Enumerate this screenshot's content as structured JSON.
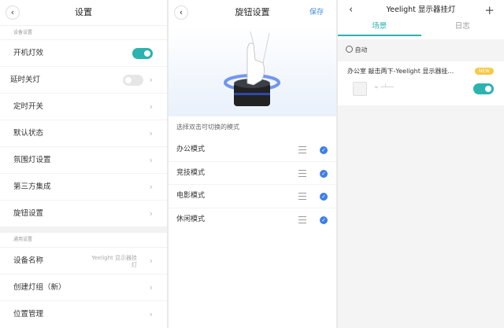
{
  "settings": {
    "title": "设置",
    "section1": "设备设置",
    "items1": [
      {
        "label": "开机灯效",
        "toggle": true
      },
      {
        "label": "延时关灯",
        "toggle": false
      },
      {
        "label": "定时开关"
      },
      {
        "label": "默认状态"
      },
      {
        "label": "氛围灯设置"
      },
      {
        "label": "第三方集成"
      },
      {
        "label": "旋钮设置"
      }
    ],
    "section2": "通用设置",
    "items2": [
      {
        "label": "设备名称",
        "value": "Yeelight 显示器挂灯"
      },
      {
        "label": "创建灯组（新）"
      },
      {
        "label": "位置管理"
      }
    ]
  },
  "knob": {
    "title": "旋钮设置",
    "save": "保存",
    "caption": "选择双击可切换的模式",
    "modes": [
      {
        "label": "办公模式",
        "checked": true
      },
      {
        "label": "竞技模式",
        "checked": true
      },
      {
        "label": "电影模式",
        "checked": true
      },
      {
        "label": "休闲模式",
        "checked": true
      }
    ]
  },
  "device": {
    "title": "Yeelight 显示器挂灯",
    "tabs": [
      "场景",
      "日志"
    ],
    "active_tab": "场景",
    "auto": "自动",
    "scene": {
      "title": "办公室 敲击两下-Yeelight 显示器挂…",
      "badge": "NEW",
      "enabled": true
    }
  },
  "colors": {
    "accent": "#2bb3b0",
    "blue": "#3d7fe6"
  }
}
